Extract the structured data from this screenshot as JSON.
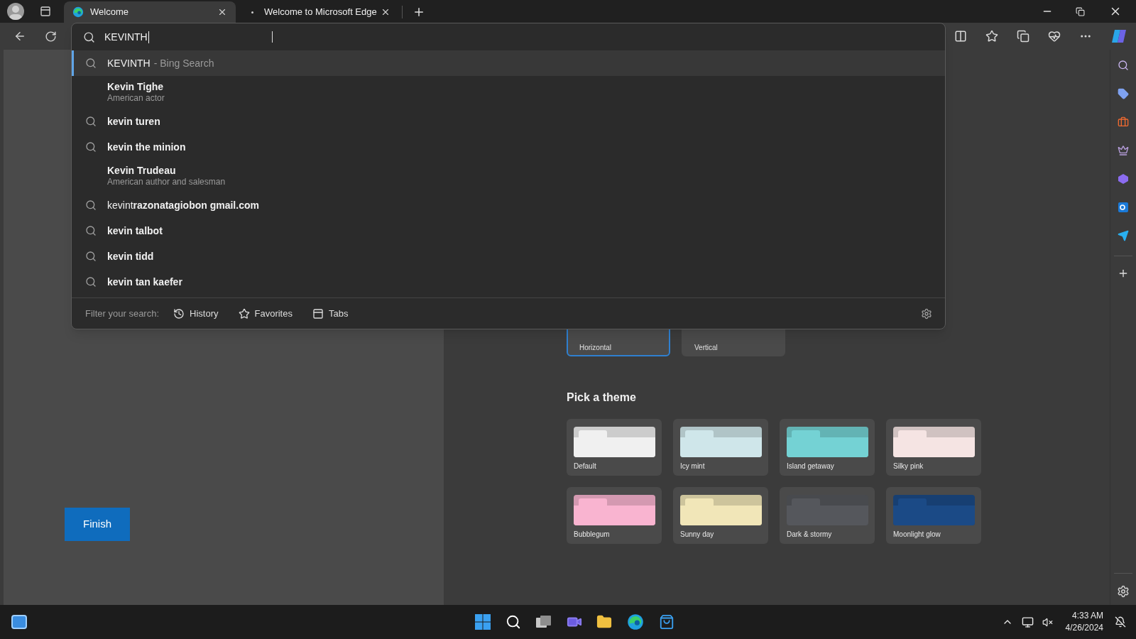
{
  "tabs": [
    {
      "title": "Welcome",
      "selected": true
    },
    {
      "title": "Welcome to Microsoft Edge",
      "selected": false
    }
  ],
  "address_bar": {
    "value": "KEVINTH"
  },
  "suggestions": [
    {
      "kind": "web",
      "text": "KEVINTH",
      "suffix": "- Bing Search",
      "selected": true
    },
    {
      "kind": "entity",
      "text": "Kevin Tighe",
      "subtitle": "American actor",
      "selected": false
    },
    {
      "kind": "search",
      "text": "kevin turen",
      "selected": false
    },
    {
      "kind": "search",
      "text": "kevin the minion",
      "selected": false
    },
    {
      "kind": "entity",
      "text": "Kevin Trudeau",
      "subtitle": "American author and salesman",
      "selected": false
    },
    {
      "kind": "completion",
      "text": "kevint**razonatagiobon gmail.com**",
      "selected": false
    },
    {
      "kind": "search",
      "text": "kevin talbot",
      "selected": false
    },
    {
      "kind": "search",
      "text": "kevin tidd",
      "selected": false
    },
    {
      "kind": "search",
      "text": "kevin tan kaefer",
      "selected": false
    }
  ],
  "filter": {
    "label": "Filter your search:",
    "options": [
      {
        "kind": "history",
        "label": "History"
      },
      {
        "kind": "favorites",
        "label": "Favorites"
      },
      {
        "kind": "tabs",
        "label": "Tabs"
      }
    ]
  },
  "finish_button": "Finish",
  "layout_options": [
    {
      "label": "Horizontal",
      "selected": true
    },
    {
      "label": "Vertical",
      "selected": false
    }
  ],
  "themes": {
    "title": "Pick a theme",
    "items": [
      {
        "name": "Default",
        "color": "#f0f0f0"
      },
      {
        "name": "Icy mint",
        "color": "#cfe6ea"
      },
      {
        "name": "Island getaway",
        "color": "#74d2d4"
      },
      {
        "name": "Silky pink",
        "color": "#f5e4e3"
      },
      {
        "name": "Bubblegum",
        "color": "#f9b4d0"
      },
      {
        "name": "Sunny day",
        "color": "#f1e6b8"
      },
      {
        "name": "Dark & stormy",
        "color": "#55575c"
      },
      {
        "name": "Moonlight glow",
        "color": "#1b4a86"
      }
    ]
  },
  "clock": {
    "time": "4:33 AM",
    "date": "4/26/2024"
  }
}
